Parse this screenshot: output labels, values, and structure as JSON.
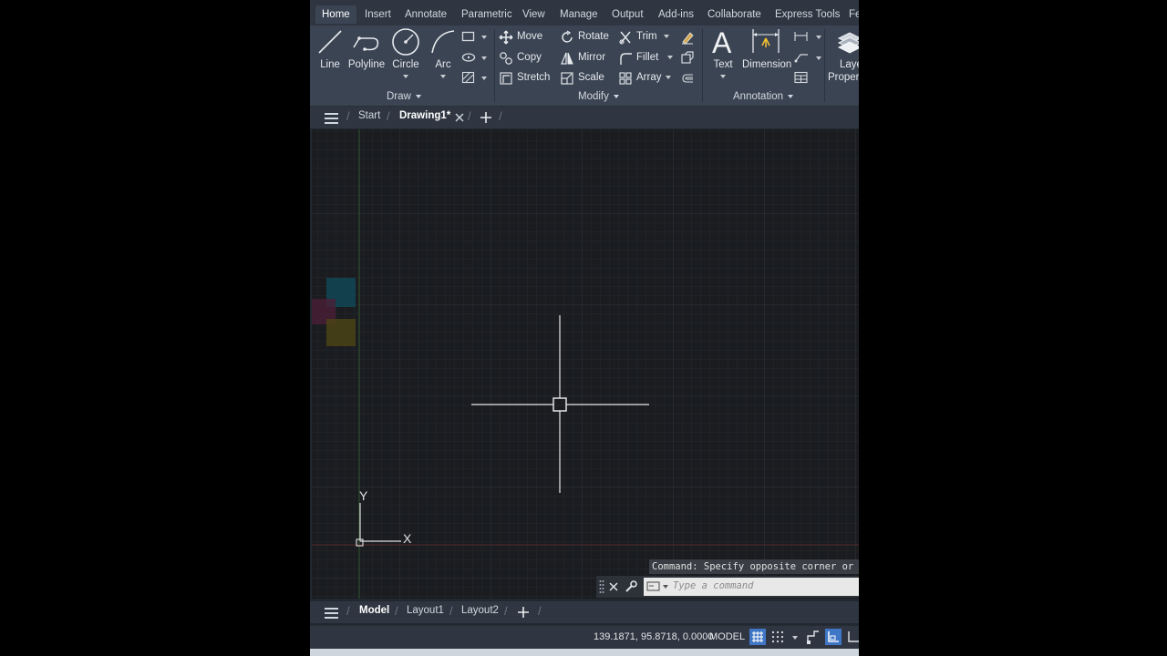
{
  "ribbon_tabs": [
    "Home",
    "Insert",
    "Annotate",
    "Parametric",
    "View",
    "Manage",
    "Output",
    "Add-ins",
    "Collaborate",
    "Express Tools",
    "Fe"
  ],
  "draw_panel": {
    "title": "Draw",
    "line": "Line",
    "polyline": "Polyline",
    "circle": "Circle",
    "arc": "Arc"
  },
  "modify_panel": {
    "title": "Modify",
    "move": "Move",
    "rotate": "Rotate",
    "trim": "Trim",
    "copy": "Copy",
    "mirror": "Mirror",
    "fillet": "Fillet",
    "stretch": "Stretch",
    "scale": "Scale",
    "array": "Array"
  },
  "annotation_panel": {
    "title": "Annotation",
    "text": "Text",
    "dimension": "Dimension"
  },
  "layers_panel": {
    "label_line1": "Laye",
    "label_line2": "Proper"
  },
  "file_tabs": {
    "start": "Start",
    "drawing": "Drawing1*"
  },
  "command": {
    "history": "Command: Specify opposite corner or",
    "placeholder": "Type a command"
  },
  "layout_tabs": [
    "Model",
    "Layout1",
    "Layout2"
  ],
  "status": {
    "coordinates": "139.1871, 95.8718, 0.0000",
    "space": "MODEL"
  },
  "ucs": {
    "x_label": "X",
    "y_label": "Y"
  }
}
